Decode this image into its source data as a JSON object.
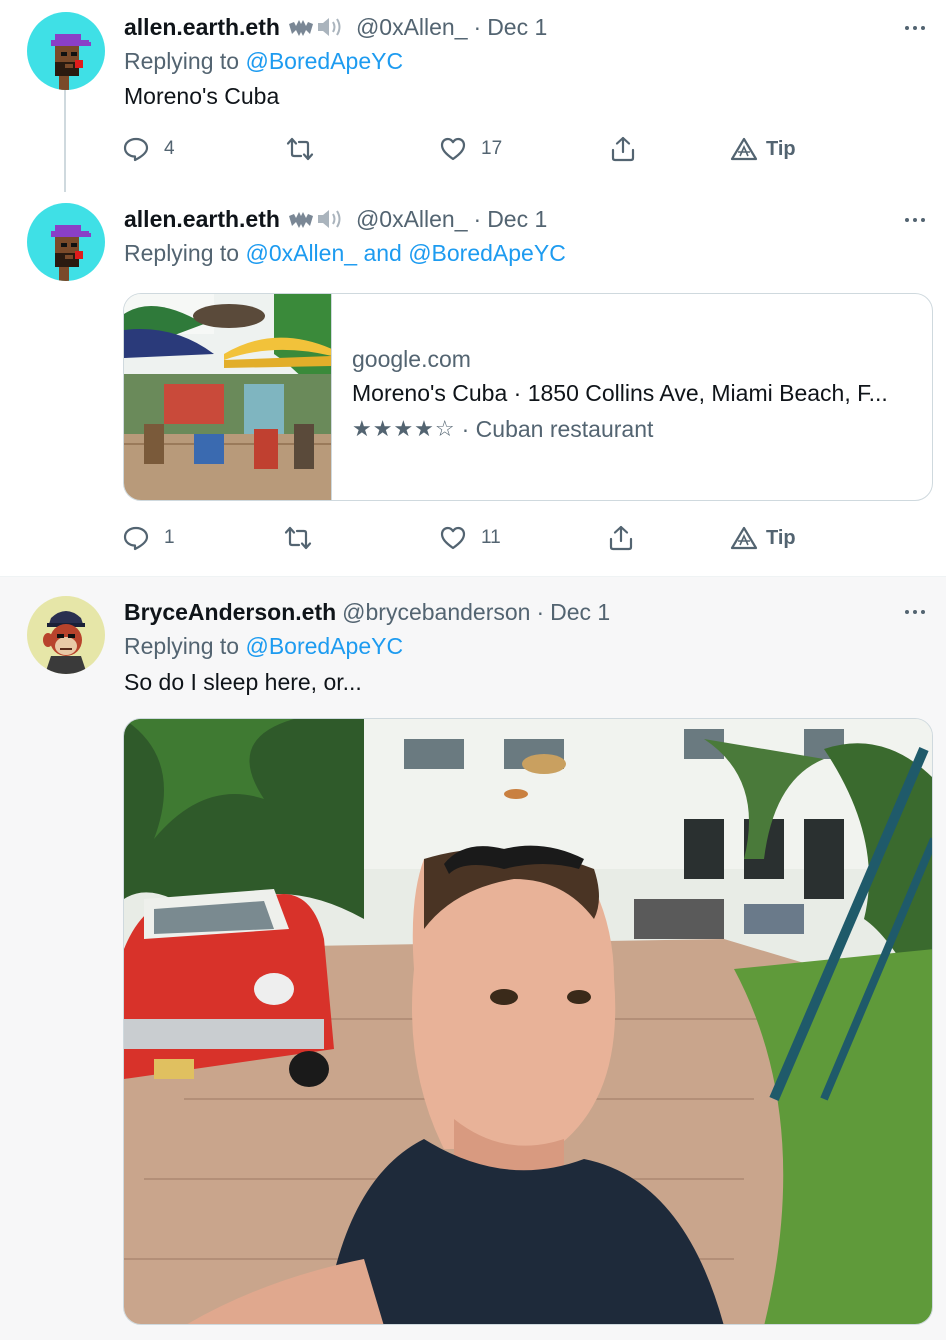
{
  "tweets": [
    {
      "display_name": "allen.earth.eth",
      "handle": "@0xAllen_",
      "separator": "·",
      "date": "Dec 1",
      "replying_prefix": "Replying to",
      "replying_to": "@BoredApeYC",
      "text": "Moreno's Cuba",
      "actions": {
        "replies": "4",
        "retweets": "",
        "likes": "17",
        "tip": "Tip"
      },
      "avatar_icon": "pixel-punk-avatar"
    },
    {
      "display_name": "allen.earth.eth",
      "handle": "@0xAllen_",
      "separator": "·",
      "date": "Dec 1",
      "replying_prefix": "Replying to",
      "replying_to_1": "@0xAllen_",
      "replying_and": "and",
      "replying_to_2": "@BoredApeYC",
      "card": {
        "domain": "google.com",
        "title": "Moreno's Cuba · 1850 Collins Ave, Miami Beach, F...",
        "stars": "★★★★☆",
        "subtitle": "· Cuban restaurant"
      },
      "actions": {
        "replies": "1",
        "retweets": "",
        "likes": "11",
        "tip": "Tip"
      },
      "avatar_icon": "pixel-punk-avatar"
    },
    {
      "display_name": "BryceAnderson.eth",
      "handle": "@brycebanderson",
      "separator": "·",
      "date": "Dec 1",
      "replying_prefix": "Replying to",
      "replying_to": "@BoredApeYC",
      "text": "So do I sleep here, or...",
      "avatar_icon": "bored-ape-avatar",
      "photo_icon": "courtyard-selfie-photo"
    }
  ],
  "colors": {
    "link": "#1d9bf0",
    "secondary_text": "#536471",
    "primary_text": "#0f1419",
    "highlight_bg": "#f7f7f8"
  }
}
